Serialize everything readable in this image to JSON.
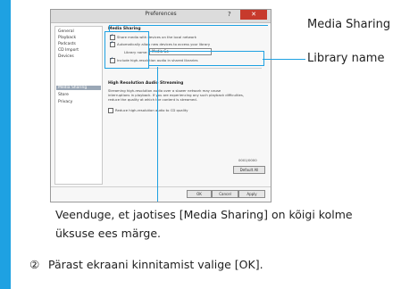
{
  "dialog": {
    "title": "Preferences",
    "help_label": "?",
    "close_label": "✕",
    "sidebar": [
      "General",
      "Playback",
      "Podcasts",
      "CD Import",
      "Devices",
      "Media Sharing",
      "Store",
      "Privacy"
    ],
    "selected_index": 5,
    "content": {
      "section1_heading": "Media Sharing",
      "opt1": "Share media with devices on the local network",
      "opt2": "Automatically allow new devices to access your library",
      "library_name_label": "Library name:",
      "library_name_value": "Media Go",
      "opt3": "Include high-resolution audio in shared libraries",
      "section2_heading": "High Resolution Audio Streaming",
      "para1": "Streaming high-resolution audio over a slower network may cause",
      "para2": "interruptions in playback. If you are experiencing any such playback difficulties,",
      "para3": "reduce the quality at which the content is streamed.",
      "reduce_label": "Reduce high-resolution audio to CD quality",
      "counter": "0001/0000",
      "default_btn": "Default All",
      "ok_btn": "OK",
      "cancel_btn": "Cancel",
      "apply_btn": "Apply"
    }
  },
  "callouts": {
    "media_sharing": "Media Sharing",
    "library_name": "Library name"
  },
  "body": {
    "line1": "Veenduge, et jaotises [Media Sharing] on kõigi kolme",
    "line2": "üksuse ees märge.",
    "step_num": "②",
    "step_text": "Pärast ekraani kinnitamist valige [OK]."
  },
  "colors": {
    "accent": "#1ea1e2",
    "close": "#c73a2c"
  }
}
